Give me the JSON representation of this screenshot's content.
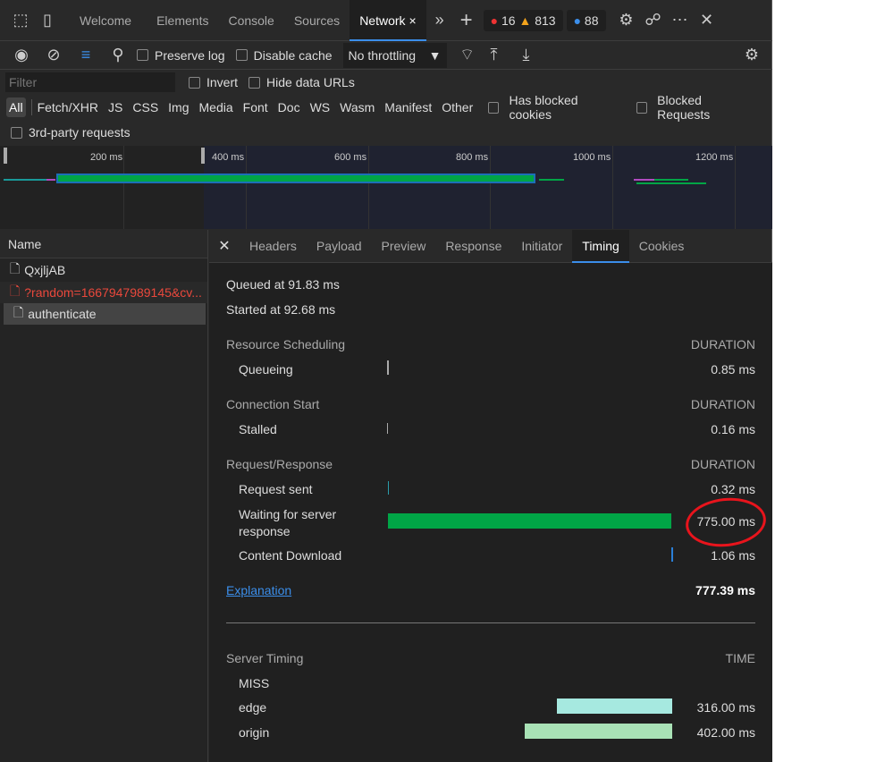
{
  "tabs": {
    "welcome": "Welcome",
    "elements": "Elements",
    "console": "Console",
    "sources": "Sources",
    "network": "Network",
    "errors": "16",
    "warnings": "813",
    "issues": "88"
  },
  "toolbar": {
    "preserve_log": "Preserve log",
    "disable_cache": "Disable cache",
    "throttling": "No throttling"
  },
  "filter": {
    "placeholder": "Filter",
    "invert": "Invert",
    "hide_data_urls": "Hide data URLs",
    "types": [
      "All",
      "Fetch/XHR",
      "JS",
      "CSS",
      "Img",
      "Media",
      "Font",
      "Doc",
      "WS",
      "Wasm",
      "Manifest",
      "Other"
    ],
    "has_blocked_cookies": "Has blocked cookies",
    "blocked_requests": "Blocked Requests",
    "third_party": "3rd-party requests"
  },
  "overview": {
    "ticks": [
      "200 ms",
      "400 ms",
      "600 ms",
      "800 ms",
      "1000 ms",
      "1200 ms"
    ]
  },
  "requests": {
    "header": "Name",
    "items": [
      {
        "name": "QxjljAB",
        "error": false
      },
      {
        "name": "?random=1667947989145&cv...",
        "error": true
      },
      {
        "name": "authenticate",
        "error": false
      }
    ]
  },
  "detail_tabs": [
    "Headers",
    "Payload",
    "Preview",
    "Response",
    "Initiator",
    "Timing",
    "Cookies"
  ],
  "timing": {
    "queued": "Queued at 91.83 ms",
    "started": "Started at 92.68 ms",
    "duration_label": "DURATION",
    "resource_scheduling": "Resource Scheduling",
    "queueing": "Queueing",
    "queueing_val": "0.85 ms",
    "connection_start": "Connection Start",
    "stalled": "Stalled",
    "stalled_val": "0.16 ms",
    "request_response": "Request/Response",
    "request_sent": "Request sent",
    "request_sent_val": "0.32 ms",
    "waiting": "Waiting for server response",
    "waiting_val": "775.00 ms",
    "content_download": "Content Download",
    "content_download_val": "1.06 ms",
    "explanation": "Explanation",
    "total": "777.39 ms",
    "server_timing": "Server Timing",
    "time_label": "TIME",
    "miss": "MISS",
    "edge": "edge",
    "edge_val": "316.00 ms",
    "origin": "origin",
    "origin_val": "402.00 ms"
  },
  "colors": {
    "waiting": "#00a546",
    "edge": "#a6e9e0",
    "origin": "#a9e2b6",
    "annotation": "#e8141c",
    "accent": "#3b8eea"
  }
}
